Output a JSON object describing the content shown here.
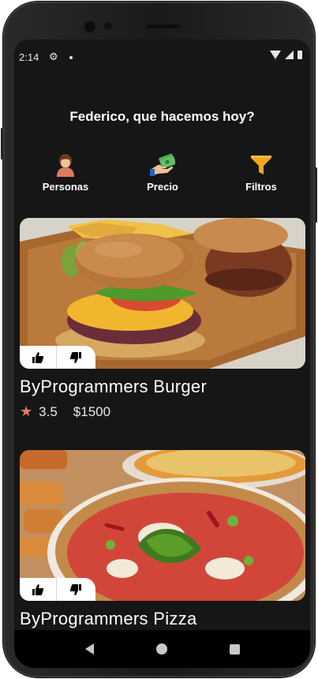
{
  "status_bar": {
    "time": "2:14",
    "icons": [
      "gear-icon",
      "dot-icon",
      "wifi-icon",
      "signal-icon",
      "battery-icon"
    ]
  },
  "header": {
    "greeting": "Federico, que hacemos hoy?"
  },
  "filters": [
    {
      "label": "Personas",
      "icon": "person-icon"
    },
    {
      "label": "Precio",
      "icon": "money-icon"
    },
    {
      "label": "Filtros",
      "icon": "funnel-icon"
    }
  ],
  "restaurants": [
    {
      "name": "ByProgrammers Burger",
      "rating": "3.5",
      "price": "$1500",
      "image": "burger-photo",
      "vote_icons": [
        "thumbs-up-icon",
        "thumbs-down-icon"
      ]
    },
    {
      "name": "ByProgrammers Pizza",
      "image": "pizza-photo",
      "vote_icons": [
        "thumbs-up-icon",
        "thumbs-down-icon"
      ]
    }
  ],
  "nav_bar": {
    "icons": [
      "back-icon",
      "home-icon",
      "recents-icon"
    ]
  },
  "colors": {
    "background": "#161616",
    "accent_orange": "#f5a623",
    "star": "#f07a62"
  }
}
